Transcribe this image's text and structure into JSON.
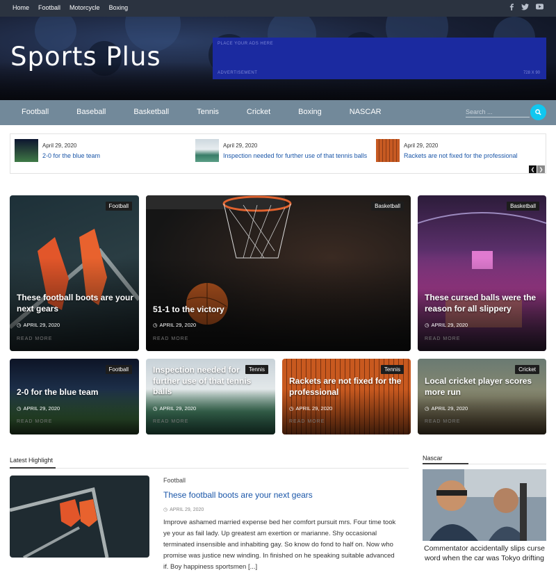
{
  "topbar": {
    "links": [
      "Home",
      "Football",
      "Motorcycle",
      "Boxing"
    ],
    "social": [
      "facebook-icon",
      "twitter-icon",
      "youtube-icon"
    ]
  },
  "site": {
    "title": "Sports Plus"
  },
  "ad": {
    "top_text": "PLACE YOUR ADS HERE",
    "bottom_text": "ADVERTISEMENT",
    "size": "728 X 90",
    "color": "#1b2aa0"
  },
  "nav": {
    "items": [
      "Football",
      "Baseball",
      "Basketball",
      "Tennis",
      "Cricket",
      "Boxing",
      "NASCAR"
    ],
    "search_placeholder": "Search ...",
    "accent": "#11c7f0"
  },
  "ticker": [
    {
      "date": "April 29, 2020",
      "title": "2-0 for the blue team"
    },
    {
      "date": "April 29, 2020",
      "title": "Inspection needed for further use of that tennis balls"
    },
    {
      "date": "April 29, 2020",
      "title": "Rackets are not fixed for the professional"
    }
  ],
  "featured": [
    {
      "tag": "Football",
      "title": "These football boots are your next gears",
      "date": "APRIL 29, 2020",
      "more": "READ MORE"
    },
    {
      "tag": "Basketball",
      "title": "51-1 to the victory",
      "date": "APRIL 29, 2020",
      "more": "READ MORE"
    },
    {
      "tag": "Basketball",
      "title": "These cursed balls were the reason for all slippery",
      "date": "APRIL 29, 2020",
      "more": "READ MORE"
    },
    {
      "tag": "Football",
      "title": "2-0 for the blue team",
      "date": "APRIL 29, 2020",
      "more": "READ MORE"
    },
    {
      "tag": "Tennis",
      "title": "Inspection needed for further use of that tennis balls",
      "date": "APRIL 29, 2020",
      "more": "READ MORE"
    },
    {
      "tag": "Tennis",
      "title": "Rackets are not fixed for the professional",
      "date": "APRIL 29, 2020",
      "more": "READ MORE"
    },
    {
      "tag": "Cricket",
      "title": "Local cricket player scores more run",
      "date": "APRIL 29, 2020",
      "more": "READ MORE"
    }
  ],
  "latest": {
    "heading": "Latest Highlight",
    "category": "Football",
    "title": "These football boots are your next gears",
    "date": "APRIL 29, 2020",
    "excerpt": "Improve ashamed married expense bed her comfort pursuit mrs. Four time took ye your as fail lady. Up greatest am exertion or marianne. Shy occasional terminated insensible and inhabiting gay. So know do fond to half on. Now who promise was justice new winding. In finished on he speaking suitable advanced if. Boy happiness sportsmen [...]"
  },
  "nascar": {
    "heading": "Nascar",
    "title": "Commentator accidentally slips curse word when the car was Tokyo drifting"
  }
}
